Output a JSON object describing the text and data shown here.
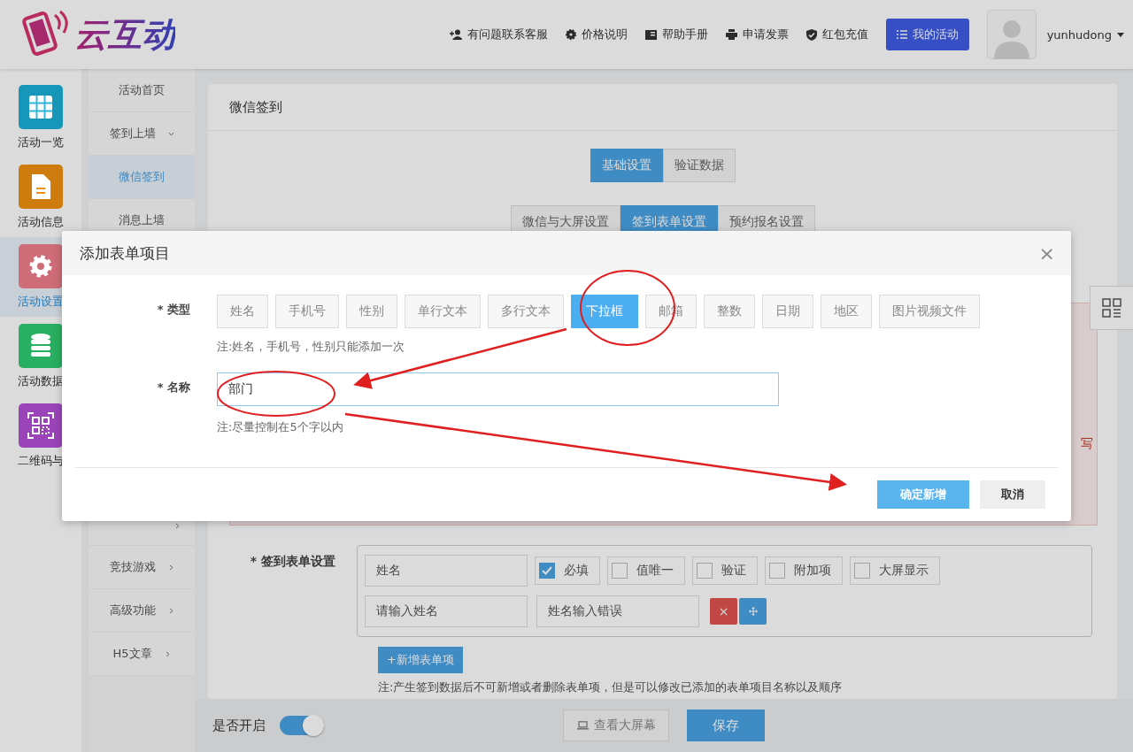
{
  "header": {
    "logo_text": "云互动",
    "links": [
      {
        "label": "有问题联系客服",
        "kind": "support"
      },
      {
        "label": "价格说明",
        "kind": "price"
      },
      {
        "label": "帮助手册",
        "kind": "manual"
      },
      {
        "label": "申请发票",
        "kind": "invoice"
      },
      {
        "label": "红包充值",
        "kind": "recharge"
      }
    ],
    "my_activity": "我的活动",
    "username": "yunhudong"
  },
  "nav": [
    {
      "label": "活动一览",
      "kind": "grid",
      "color": "#1697ba",
      "selected": false
    },
    {
      "label": "活动信息",
      "kind": "doc",
      "color": "#ce7c0d",
      "selected": false
    },
    {
      "label": "活动设置",
      "kind": "gear",
      "color": "#ce6d78",
      "selected": true
    },
    {
      "label": "活动数据",
      "kind": "db",
      "color": "#28af61",
      "selected": false
    },
    {
      "label": "二维码与",
      "kind": "qr",
      "color": "#9b44ba",
      "selected": false
    }
  ],
  "submenu_top": [
    {
      "label": "活动首页",
      "selected": false
    },
    {
      "label": "签到上墙",
      "selected": false,
      "expanded": true
    },
    {
      "label": "微信签到",
      "selected": true
    },
    {
      "label": "消息上墙",
      "selected": false
    }
  ],
  "submenu_bottom": [
    {
      "label": "竞技游戏",
      "expanded": false
    },
    {
      "label": "高级功能",
      "expanded": false
    },
    {
      "label": "H5文章",
      "expanded": false
    }
  ],
  "panel": {
    "title": "微信签到",
    "tabs": [
      {
        "label": "基础设置",
        "selected": true
      },
      {
        "label": "验证数据",
        "selected": false
      }
    ],
    "subtabs": [
      {
        "label": "微信与大屏设置",
        "selected": false
      },
      {
        "label": "签到表单设置",
        "selected": true
      },
      {
        "label": "预约报名设置",
        "selected": false
      }
    ],
    "alert_fragment": "写",
    "form_label": "* 签到表单设置",
    "field_name": "姓名",
    "options": [
      {
        "label": "必填",
        "checked": true
      },
      {
        "label": "值唯一",
        "checked": false
      },
      {
        "label": "验证",
        "checked": false
      },
      {
        "label": "附加项",
        "checked": false
      },
      {
        "label": "大屏显示",
        "checked": false
      }
    ],
    "placeholder_value": "请输入姓名",
    "error_value": "姓名输入错误",
    "delete": "×",
    "add_button": "+新增表单项",
    "note": "注:产生签到数据后不可新增或者删除表单项，但是可以修改已添加的表单项目名称以及顺序"
  },
  "footer": {
    "toggle_label": "是否开启",
    "on": true,
    "view_button": "查看大屏幕",
    "save_button": "保存"
  },
  "modal": {
    "title": "添加表单项目",
    "close": "×",
    "type_label": "* 类型",
    "types": [
      {
        "label": "姓名",
        "selected": false
      },
      {
        "label": "手机号",
        "selected": false
      },
      {
        "label": "性别",
        "selected": false
      },
      {
        "label": "单行文本",
        "selected": false
      },
      {
        "label": "多行文本",
        "selected": false
      },
      {
        "label": "下拉框",
        "selected": true
      },
      {
        "label": "邮箱",
        "selected": false
      },
      {
        "label": "整数",
        "selected": false
      },
      {
        "label": "日期",
        "selected": false
      },
      {
        "label": "地区",
        "selected": false
      },
      {
        "label": "图片视频文件",
        "selected": false
      }
    ],
    "type_note": "注:姓名，手机号，性别只能添加一次",
    "name_label": "* 名称",
    "name_value": "部门",
    "name_note": "注:尽量控制在5个字以内",
    "confirm": "确定新增",
    "cancel": "取消"
  }
}
